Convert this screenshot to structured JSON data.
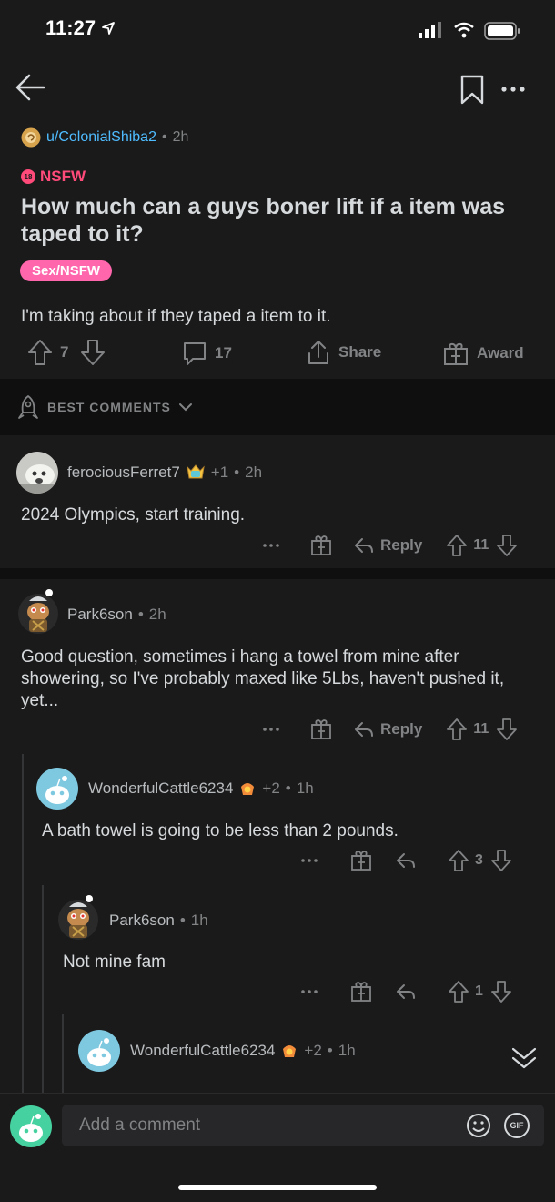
{
  "status": {
    "time": "11:27"
  },
  "post": {
    "author": "u/ColonialShiba2",
    "age": "2h",
    "nsfw_label": "NSFW",
    "title": "How much can a guys boner lift if a item was taped to it?",
    "flair": "Sex/NSFW",
    "body": "I'm taking about if they taped a item to it.",
    "votes": "7",
    "comments": "17",
    "share_label": "Share",
    "award_label": "Award"
  },
  "sort": {
    "label": "BEST COMMENTS"
  },
  "comments": [
    {
      "author": "ferociousFerret7",
      "extra": "+1",
      "age": "2h",
      "text": "2024 Olympics, start training.",
      "reply_label": "Reply",
      "votes": "11"
    },
    {
      "author": "Park6son",
      "age": "2h",
      "text": "Good question, sometimes i hang a towel from mine after showering, so I've probably maxed like 5Lbs, haven't pushed it, yet...",
      "reply_label": "Reply",
      "votes": "11"
    },
    {
      "author": "WonderfulCattle6234",
      "extra": "+2",
      "age": "1h",
      "text": "A bath towel is going to be less than 2 pounds.",
      "votes": "3"
    },
    {
      "author": "Park6son",
      "age": "1h",
      "text": "Not mine fam",
      "votes": "1"
    },
    {
      "author": "WonderfulCattle6234",
      "extra": "+2",
      "age": "1h"
    }
  ],
  "composer": {
    "placeholder": "Add a comment",
    "gif_label": "GIF"
  },
  "separator": "•",
  "colors": {
    "background": "#1a1a1b",
    "nsfw": "#ff4a7a",
    "flair": "#ff66ac",
    "link": "#4fbcff"
  }
}
